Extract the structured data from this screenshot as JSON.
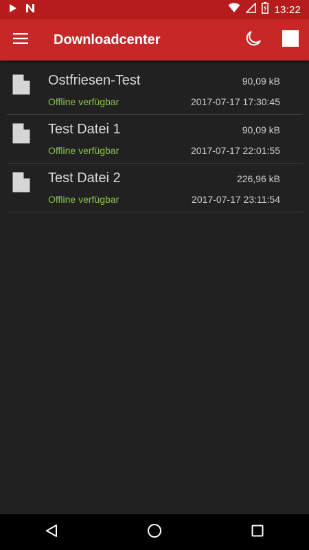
{
  "status_bar": {
    "time": "13:22",
    "icons": [
      "play-store-icon",
      "notification-n-icon",
      "wifi-icon",
      "signal-icon",
      "battery-charging-icon"
    ]
  },
  "app_bar": {
    "title": "Downloadcenter",
    "menu_icon": "hamburger-menu-icon",
    "actions": [
      "night-mode-icon",
      "stop-icon"
    ]
  },
  "files": [
    {
      "name": "Ostfriesen-Test",
      "size": "90,09 kB",
      "status": "Offline verfügbar",
      "date": "2017-07-17 17:30:45"
    },
    {
      "name": "Test Datei 1",
      "size": "90,09 kB",
      "status": "Offline verfügbar",
      "date": "2017-07-17 22:01:55"
    },
    {
      "name": "Test Datei 2",
      "size": "226,96 kB",
      "status": "Offline verfügbar",
      "date": "2017-07-17 23:11:54"
    }
  ],
  "nav_bar": {
    "buttons": [
      "back-icon",
      "home-icon",
      "recents-icon"
    ]
  },
  "colors": {
    "app_bar": "#c62828",
    "status_bar": "#b71c1c",
    "background": "#212121",
    "status_text": "#8bc34a"
  }
}
